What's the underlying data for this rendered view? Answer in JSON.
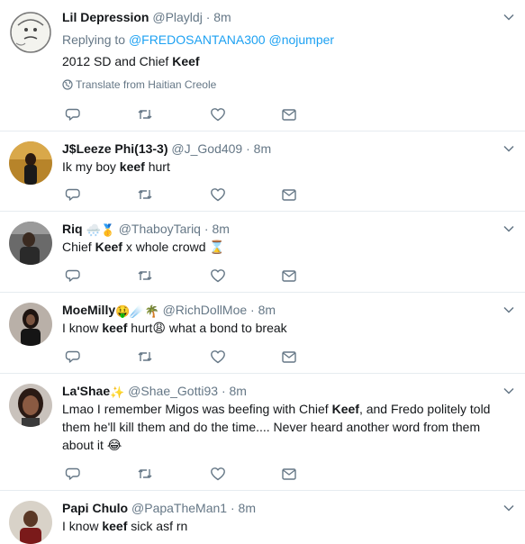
{
  "tweets": [
    {
      "name": "Lil Depression",
      "handle": "@Playldj",
      "time": "8m",
      "reply_prefix": "Replying to",
      "reply_mentions": [
        "@FREDOSANTANA300",
        "@nojumper"
      ],
      "text_parts": [
        "2012 SD and Chief ",
        "Keef",
        ""
      ],
      "translate": "Translate from Haitian Creole"
    },
    {
      "name": "J$Leeze Phi(13-3)",
      "handle": "@J_God409",
      "time": "8m",
      "text_parts": [
        "Ik my boy ",
        "keef",
        " hurt"
      ]
    },
    {
      "name": "Riq",
      "name_emojis": "🌨️🥇",
      "handle": "@ThaboyTariq",
      "time": "8m",
      "text_parts": [
        "Chief ",
        "Keef",
        " x whole crowd ⌛"
      ]
    },
    {
      "name": "MoeMilly",
      "name_emojis": "🤑☄️🌴",
      "handle": "@RichDollMoe",
      "time": "8m",
      "text_parts": [
        "I know ",
        "keef",
        " hurt😩 what a bond to break"
      ]
    },
    {
      "name": "La'Shae",
      "name_emojis": "✨",
      "handle": "@Shae_Gotti93",
      "time": "8m",
      "text_parts": [
        "Lmao I remember Migos was beefing with Chief ",
        "Keef",
        ", and Fredo politely told them he'll kill them and do the time.... Never heard another word from them about it 😂"
      ]
    },
    {
      "name": "Papi Chulo",
      "handle": "@PapaTheMan1",
      "time": "8m",
      "text_parts": [
        "I know ",
        "keef",
        " sick asf rn"
      ]
    }
  ],
  "separator": "·",
  "icons": {
    "reply": "reply-icon",
    "retweet": "retweet-icon",
    "like": "like-icon",
    "dm": "direct-message-icon",
    "caret": "chevron-down-icon",
    "globe": "globe-icon"
  },
  "colors": {
    "text": "#14171a",
    "muted": "#657786",
    "link": "#1da1f2",
    "border": "#e6ecf0"
  }
}
